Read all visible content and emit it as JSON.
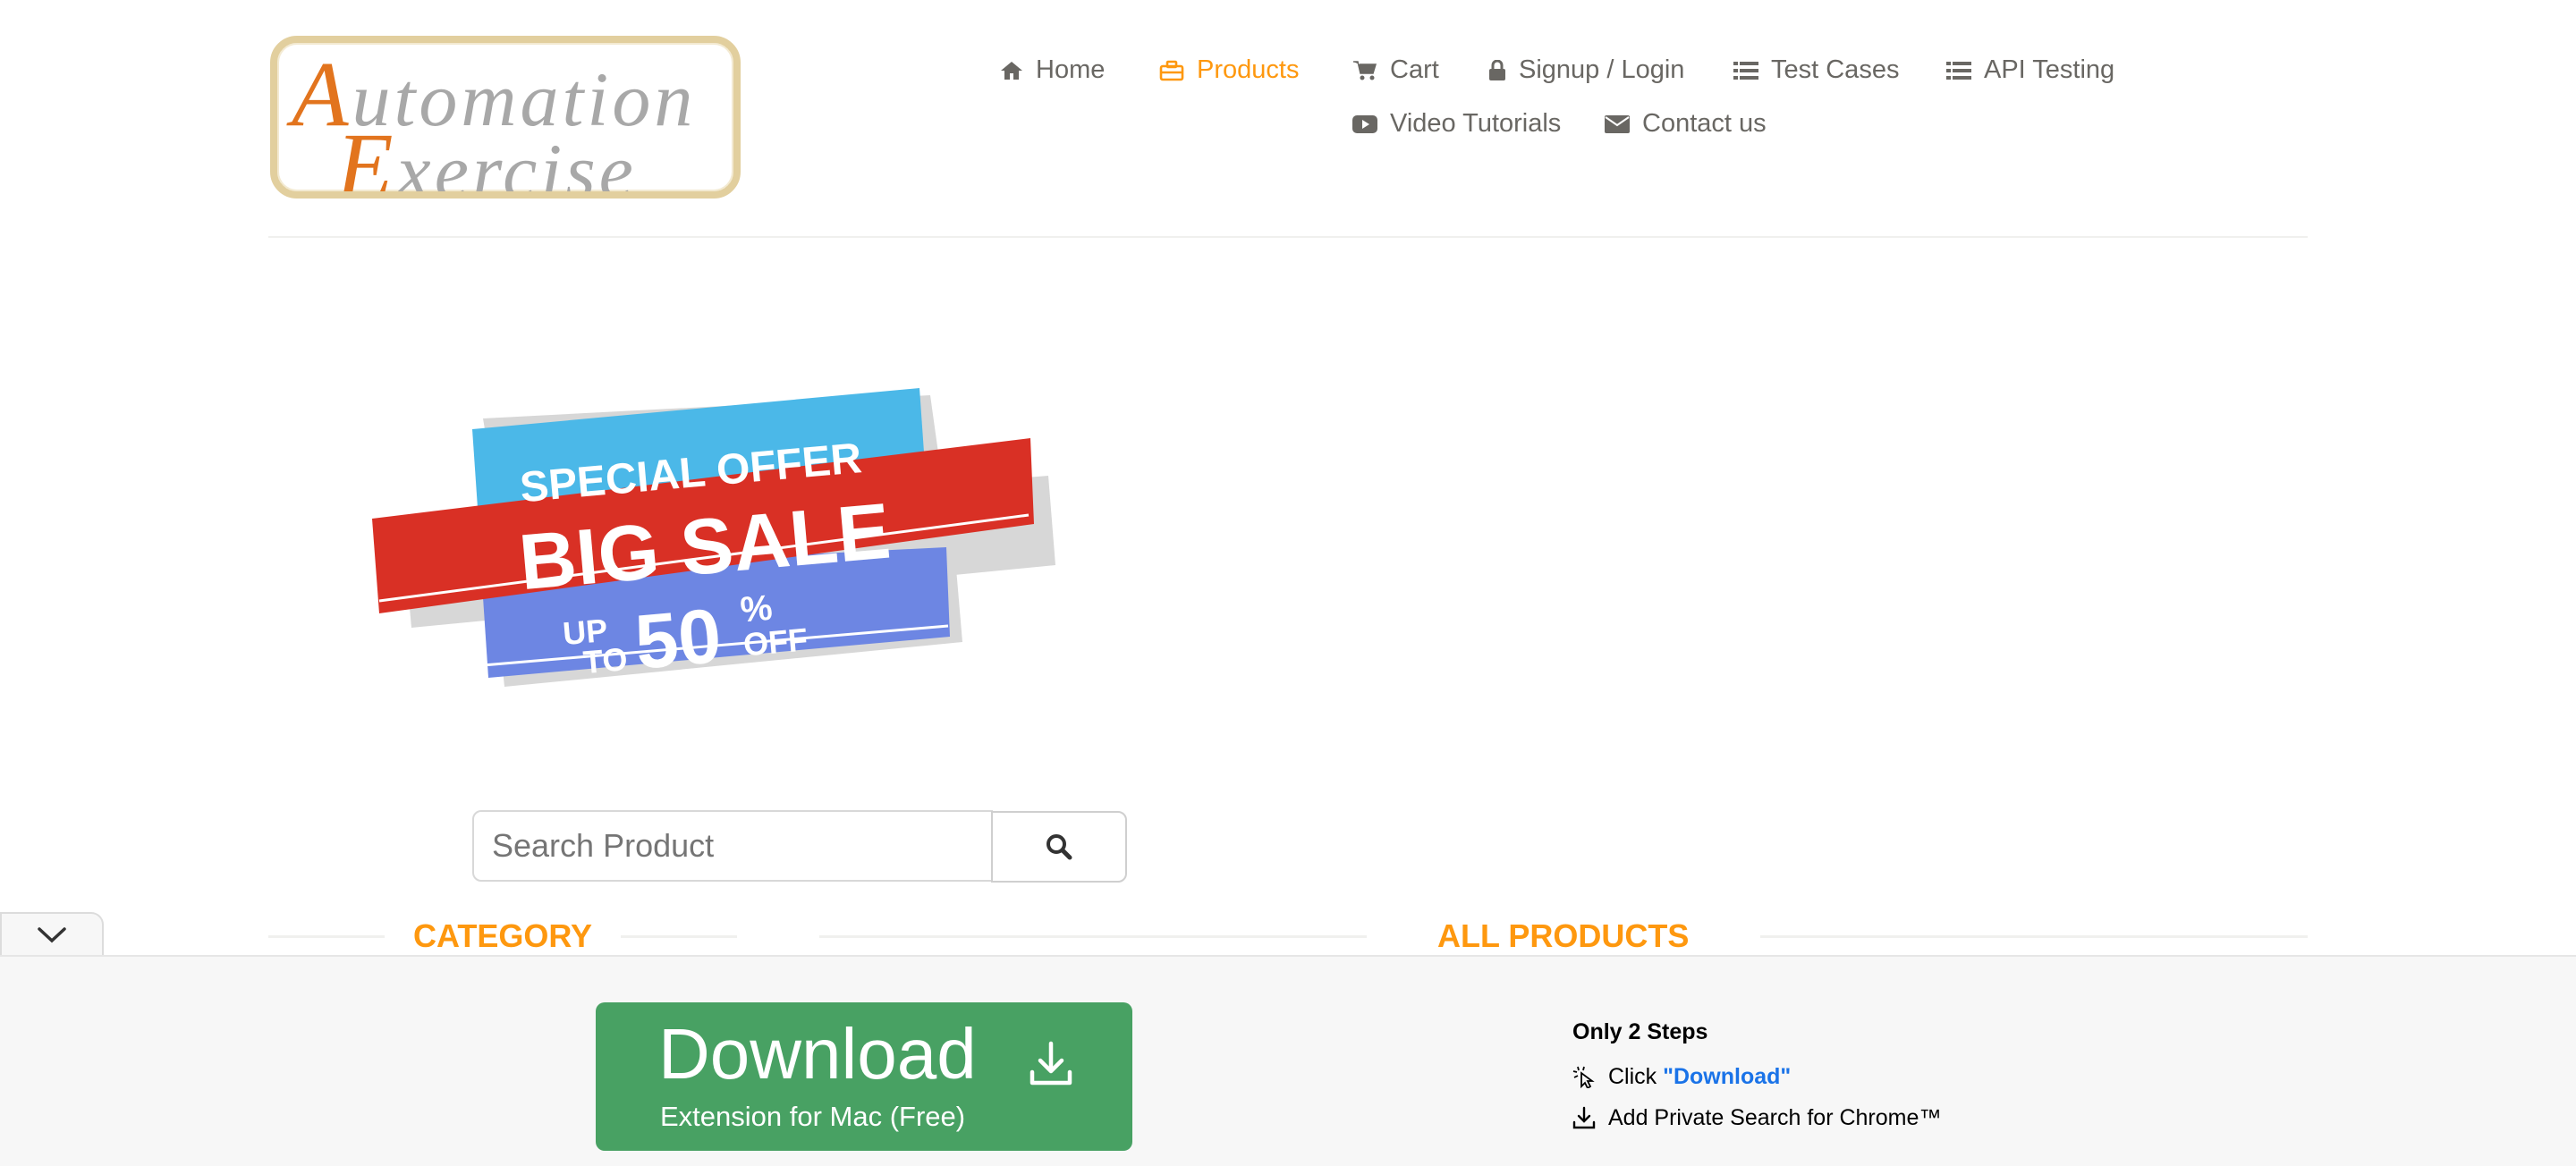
{
  "brand": {
    "logo_line1_cap": "A",
    "logo_line1_rest": "utomation",
    "logo_line2_cap": "E",
    "logo_line2_rest": "xercise"
  },
  "nav": {
    "items": [
      {
        "label": "Home",
        "icon": "home-icon"
      },
      {
        "label": "Products",
        "icon": "briefcase-icon",
        "active": true
      },
      {
        "label": "Cart",
        "icon": "cart-icon"
      },
      {
        "label": "Signup / Login",
        "icon": "lock-icon"
      },
      {
        "label": "Test Cases",
        "icon": "list-icon"
      },
      {
        "label": "API Testing",
        "icon": "list-icon"
      },
      {
        "label": "Video Tutorials",
        "icon": "youtube-play-icon"
      },
      {
        "label": "Contact us",
        "icon": "envelope-icon"
      }
    ]
  },
  "banner": {
    "line1": "SPECIAL OFFER",
    "line2": "BIG SALE",
    "line3_prefix_a": "UP",
    "line3_prefix_b": "TO",
    "line3_number": "50",
    "line3_pct": "%",
    "line3_suffix": "OFF"
  },
  "search": {
    "placeholder": "Search Product"
  },
  "sections": {
    "category": "CATEGORY",
    "all_products": "ALL PRODUCTS"
  },
  "extension": {
    "download_title": "Download",
    "download_subtitle": "Extension for Mac (Free)",
    "steps_title": "Only 2 Steps",
    "step1_prefix": "Click ",
    "step1_highlight": "\"Download\"",
    "step2": "Add Private Search for Chrome™"
  },
  "colors": {
    "accent": "#fe980f",
    "nav_text": "#696763",
    "download_green": "#48a163",
    "banner_blue_light": "#4bb8e8",
    "banner_red": "#d93025",
    "banner_blue": "#6d86e3"
  }
}
